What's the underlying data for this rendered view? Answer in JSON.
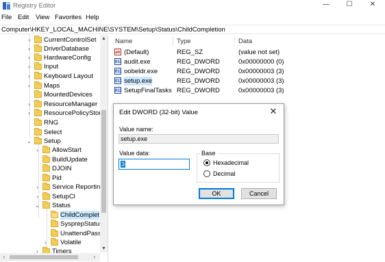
{
  "window": {
    "title": "Registry Editor",
    "min_glyph": "—",
    "max_glyph": "☐",
    "close_glyph": "✕"
  },
  "menu": [
    "File",
    "Edit",
    "View",
    "Favorites",
    "Help"
  ],
  "address": "Computer\\HKEY_LOCAL_MACHINE\\SYSTEM\\Setup\\Status\\ChildCompletion",
  "tree": [
    {
      "label": "CurrentControlSet",
      "expander": "›"
    },
    {
      "label": "DriverDatabase",
      "expander": "›"
    },
    {
      "label": "HardwareConfig",
      "expander": "›"
    },
    {
      "label": "Input",
      "expander": "›"
    },
    {
      "label": "Keyboard Layout",
      "expander": "›"
    },
    {
      "label": "Maps",
      "expander": "›"
    },
    {
      "label": "MountedDevices",
      "expander": ""
    },
    {
      "label": "ResourceManager",
      "expander": "›"
    },
    {
      "label": "ResourcePolicyStore",
      "expander": "›"
    },
    {
      "label": "RNG",
      "expander": ""
    },
    {
      "label": "Select",
      "expander": ""
    },
    {
      "label": "Setup",
      "expander": "⌄"
    },
    {
      "label": "AllowStart",
      "expander": "›"
    },
    {
      "label": "BuildUpdate",
      "expander": ""
    },
    {
      "label": "DJOIN",
      "expander": ""
    },
    {
      "label": "Pid",
      "expander": ""
    },
    {
      "label": "Service Reporting",
      "expander": "›"
    },
    {
      "label": "SetupCl",
      "expander": "›"
    },
    {
      "label": "Status",
      "expander": "⌄"
    },
    {
      "label": "ChildComplet",
      "expander": ""
    },
    {
      "label": "SysprepStatus",
      "expander": ""
    },
    {
      "label": "UnattendPasse",
      "expander": ""
    },
    {
      "label": "Volatile",
      "expander": "›"
    },
    {
      "label": "Timers",
      "expander": "›"
    }
  ],
  "columns": {
    "name": "Name",
    "type": "Type",
    "data": "Data"
  },
  "values": [
    {
      "icon": "string-value-icon",
      "glyph": "ab",
      "name": "(Default)",
      "type": "REG_SZ",
      "data": "(value not set)"
    },
    {
      "icon": "dword-value-icon",
      "glyph": "011",
      "name": "audit.exe",
      "type": "REG_DWORD",
      "data": "0x00000000 (0)"
    },
    {
      "icon": "dword-value-icon",
      "glyph": "011",
      "name": "oobeldr.exe",
      "type": "REG_DWORD",
      "data": "0x00000003 (3)"
    },
    {
      "icon": "dword-value-icon",
      "glyph": "011",
      "name": "setup.exe",
      "type": "REG_DWORD",
      "data": "0x00000003 (3)"
    },
    {
      "icon": "dword-value-icon",
      "glyph": "011",
      "name": "SetupFinalTasks",
      "type": "REG_DWORD",
      "data": "0x00000003 (3)"
    }
  ],
  "dialog": {
    "title": "Edit DWORD (32-bit) Value",
    "close_glyph": "✕",
    "value_name_label": "Value name:",
    "value_name": "setup.exe",
    "value_data_label": "Value data:",
    "value_data": "3",
    "base_label": "Base",
    "radix_options": [
      {
        "label": "Hexadecimal",
        "selected": true
      },
      {
        "label": "Decimal",
        "selected": false
      }
    ],
    "ok_label": "OK",
    "cancel_label": "Cancel"
  }
}
